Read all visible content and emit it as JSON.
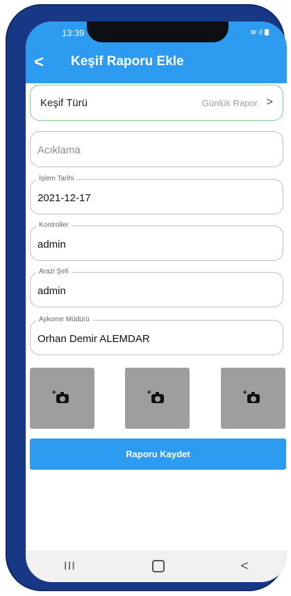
{
  "status_bar": {
    "time": "13:39"
  },
  "header": {
    "back_icon": "chevron-left-icon",
    "title": "Keşif Raporu Ekle",
    "color": "#2d9bf0"
  },
  "kesif": {
    "label": "Keşif Türü",
    "value": "Günlük Rapor"
  },
  "aciklama": {
    "placeholder": "Acıklama"
  },
  "fields": [
    {
      "label": "İşlem Tarihi",
      "value": "2021-12-17"
    },
    {
      "label": "Kontroller",
      "value": "admin"
    },
    {
      "label": "Arazi Şefi",
      "value": "admin"
    },
    {
      "label": "Aykome Müdürü",
      "value": "Orhan Demir ALEMDAR"
    }
  ],
  "photos": [
    {
      "icon": "add-photo-icon"
    },
    {
      "icon": "add-photo-icon"
    },
    {
      "icon": "add-photo-icon"
    }
  ],
  "save_button": {
    "label": "Raporu Kaydet"
  }
}
